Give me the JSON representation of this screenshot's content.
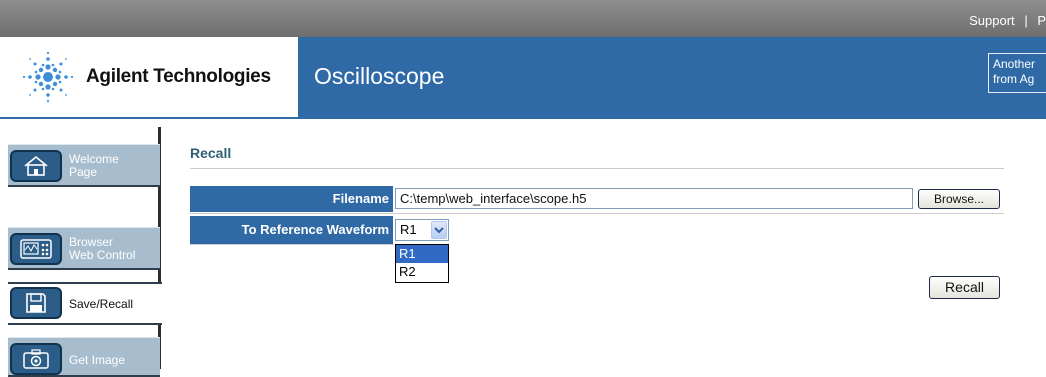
{
  "topbar": {
    "links": [
      "Support",
      "|",
      "P"
    ]
  },
  "header": {
    "brand": "Agilent Technologies",
    "app_title": "Oscilloscope",
    "promo_line1": "Another",
    "promo_line2": "from Ag"
  },
  "nav": {
    "items": [
      {
        "label_line1": "Welcome",
        "label_line2": "Page",
        "icon": "home-icon",
        "active": false
      },
      {
        "label_line1": "Browser",
        "label_line2": "Web Control",
        "icon": "scope-front-panel-icon",
        "active": false
      },
      {
        "label_line1": "Save/Recall",
        "label_line2": "",
        "icon": "floppy-disk-icon",
        "active": true
      },
      {
        "label_line1": "Get Image",
        "label_line2": "",
        "icon": "camera-icon",
        "active": false
      }
    ]
  },
  "recall": {
    "title": "Recall",
    "filename_label": "Filename",
    "filename_value": "C:\\temp\\web_interface\\scope.h5",
    "browse_label": "Browse...",
    "ref_label": "To Reference Waveform",
    "ref_selected": "R1",
    "ref_options": [
      "R1",
      "R2"
    ],
    "recall_button": "Recall"
  },
  "colors": {
    "header_blue": "#2f6aa6",
    "nav_inactive": "#a7bccd",
    "title_teal": "#2f5f78"
  }
}
